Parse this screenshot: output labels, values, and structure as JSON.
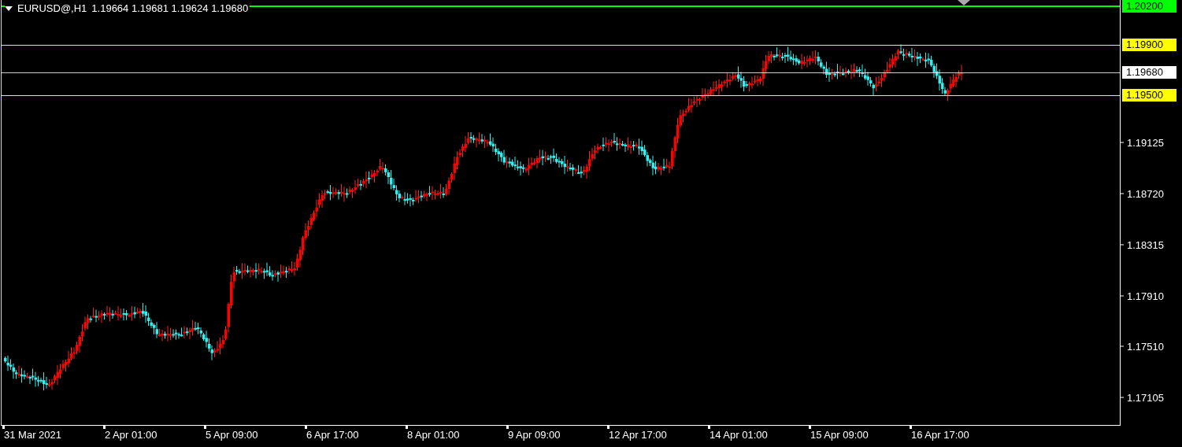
{
  "header": {
    "symbol": "EURUSD@,H1",
    "ohlc": "1.19664 1.19681 1.19624 1.19680"
  },
  "price_levels": [
    {
      "label": "1.20200",
      "color": "#00ff00",
      "kind": "alert"
    },
    {
      "label": "1.19900",
      "color": "#ffff00",
      "kind": "level"
    },
    {
      "label": "1.19680",
      "color": "#ffffff",
      "kind": "bid"
    },
    {
      "label": "1.19500",
      "color": "#ffff00",
      "kind": "level"
    }
  ],
  "price_axis": [
    "1.19125",
    "1.18720",
    "1.18315",
    "1.17910",
    "1.17510",
    "1.17105"
  ],
  "time_axis": [
    "31 Mar 2021",
    "2 Apr 01:00",
    "5 Apr 09:00",
    "6 Apr 17:00",
    "8 Apr 01:00",
    "9 Apr 09:00",
    "12 Apr 17:00",
    "14 Apr 01:00",
    "15 Apr 09:00",
    "16 Apr 17:00"
  ]
}
